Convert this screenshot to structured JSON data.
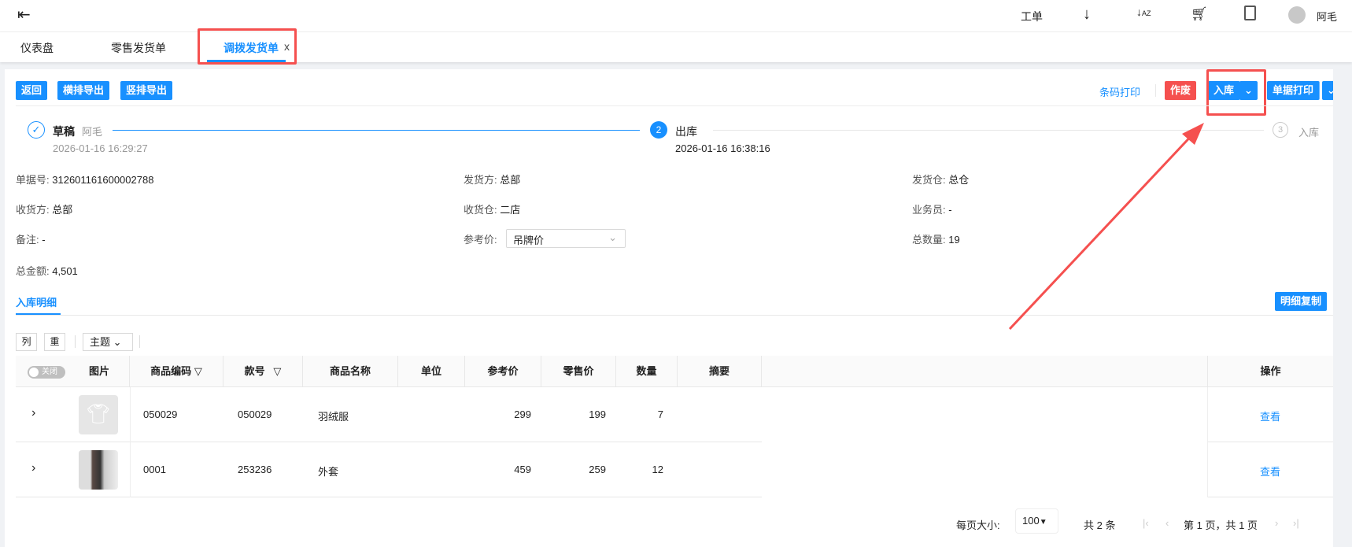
{
  "topbar": {
    "ticket": "工单",
    "user": "阿毛"
  },
  "tabs": [
    {
      "label": "仪表盘"
    },
    {
      "label": "零售发货单"
    },
    {
      "label": "调拨发货单",
      "close": "x"
    }
  ],
  "toolbar": {
    "back": "返回",
    "export_h": "横排导出",
    "export_v": "竖排导出",
    "barcode_print": "条码打印",
    "void": "作废",
    "stock_in": "入库",
    "doc_print": "单据打印"
  },
  "steps": [
    {
      "num": "1",
      "title": "草稿",
      "user": "阿毛",
      "time": "2026-01-16 16:29:27"
    },
    {
      "num": "2",
      "title": "出库",
      "time": "2026-01-16 16:38:16"
    },
    {
      "num": "3",
      "title": "入库"
    }
  ],
  "info": {
    "doc_no_label": "单据号:",
    "doc_no": "312601161600002788",
    "sender_label": "发货方:",
    "sender": "总部",
    "send_wh_label": "发货仓:",
    "send_wh": "总仓",
    "receiver_label": "收货方:",
    "receiver": "总部",
    "recv_wh_label": "收货仓:",
    "recv_wh": "二店",
    "salesman_label": "业务员:",
    "salesman": "-",
    "remark_label": "备注:",
    "remark": "-",
    "ref_price_label": "参考价:",
    "ref_price": "吊牌价",
    "total_qty_label": "总数量:",
    "total_qty": "19",
    "total_amt_label": "总金额:",
    "total_amt": "4,501"
  },
  "detail": {
    "tab": "入库明细",
    "copy": "明细复制",
    "col_btn": "列",
    "reset_btn": "重",
    "theme": "主题",
    "toggle": "关闭"
  },
  "table": {
    "headers": [
      "图片",
      "商品编码",
      "款号",
      "商品名称",
      "单位",
      "参考价",
      "零售价",
      "数量",
      "摘要",
      "操作"
    ],
    "rows": [
      {
        "code": "050029",
        "style": "050029",
        "name": "羽绒服",
        "unit": "",
        "ref": "299",
        "retail": "199",
        "qty": "7",
        "summary": "",
        "action": "查看"
      },
      {
        "code": "0001",
        "style": "253236",
        "name": "外套",
        "unit": "",
        "ref": "459",
        "retail": "259",
        "qty": "12",
        "summary": "",
        "action": "查看"
      }
    ]
  },
  "pagination": {
    "size_label": "每页大小:",
    "size": "100",
    "total": "共 2 条",
    "page": "第 1 页，共 1 页"
  },
  "colors": {
    "primary": "#1890ff",
    "danger": "#f5504f"
  }
}
